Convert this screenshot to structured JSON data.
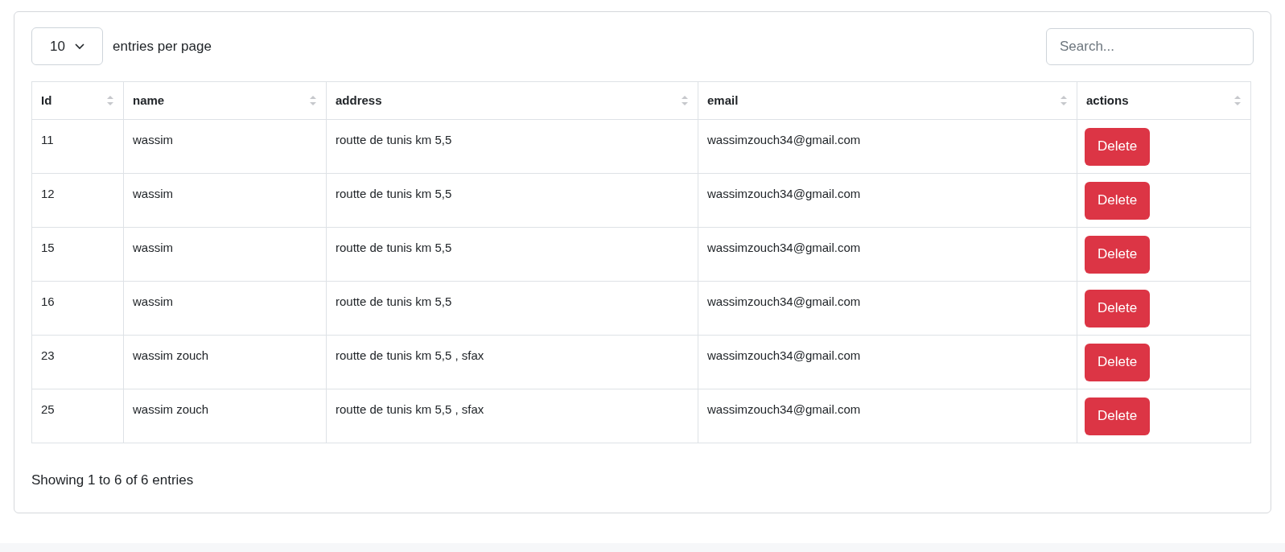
{
  "length_select": {
    "value": "10"
  },
  "length_label": "entries per page",
  "search": {
    "placeholder": "Search..."
  },
  "table": {
    "columns": [
      "Id",
      "name",
      "address",
      "email",
      "actions"
    ],
    "rows": [
      {
        "id": "11",
        "name": "wassim",
        "address": "routte de tunis km 5,5",
        "email": "wassimzouch34@gmail.com",
        "action": "Delete"
      },
      {
        "id": "12",
        "name": "wassim",
        "address": "routte de tunis km 5,5",
        "email": "wassimzouch34@gmail.com",
        "action": "Delete"
      },
      {
        "id": "15",
        "name": "wassim",
        "address": "routte de tunis km 5,5",
        "email": "wassimzouch34@gmail.com",
        "action": "Delete"
      },
      {
        "id": "16",
        "name": "wassim",
        "address": "routte de tunis km 5,5",
        "email": "wassimzouch34@gmail.com",
        "action": "Delete"
      },
      {
        "id": "23",
        "name": "wassim zouch",
        "address": "routte de tunis km 5,5 , sfax",
        "email": "wassimzouch34@gmail.com",
        "action": "Delete"
      },
      {
        "id": "25",
        "name": "wassim zouch",
        "address": "routte de tunis km 5,5 , sfax",
        "email": "wassimzouch34@gmail.com",
        "action": "Delete"
      }
    ]
  },
  "info": "Showing 1 to 6 of 6 entries"
}
